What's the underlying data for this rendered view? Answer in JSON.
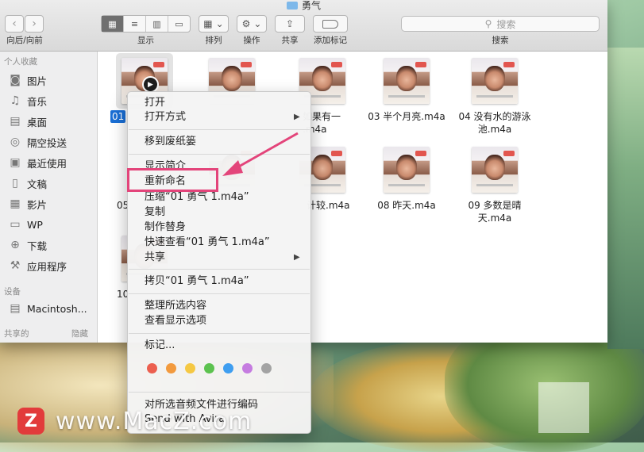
{
  "window": {
    "title": "勇气",
    "toolbar": {
      "back": "‹",
      "forward": "›",
      "nav_label": "向后/向前",
      "display_label": "显示",
      "arrange_label": "排列",
      "action_label": "操作",
      "share_label": "共享",
      "tag_label": "添加标记",
      "search_label": "搜索",
      "search_placeholder": "搜索"
    }
  },
  "sidebar": {
    "favorites_header": "个人收藏",
    "items": [
      {
        "label": "图片",
        "icon": "camera-icon"
      },
      {
        "label": "音乐",
        "icon": "music-note-icon"
      },
      {
        "label": "桌面",
        "icon": "desktop-icon"
      },
      {
        "label": "隔空投送",
        "icon": "airdrop-icon"
      },
      {
        "label": "最近使用",
        "icon": "recents-icon"
      },
      {
        "label": "文稿",
        "icon": "document-icon"
      },
      {
        "label": "影片",
        "icon": "film-icon"
      },
      {
        "label": "WP",
        "icon": "folder-icon"
      },
      {
        "label": "下载",
        "icon": "download-icon"
      },
      {
        "label": "应用程序",
        "icon": "applications-icon"
      }
    ],
    "devices_header": "设备",
    "device": "Macintosh...",
    "shared_header": "共享的",
    "hide_label": "隐藏"
  },
  "files": [
    {
      "name": "01"
    },
    {
      "name": ""
    },
    {
      "name": "如果有一\n.m4a"
    },
    {
      "name": "03 半个月亮.m4a"
    },
    {
      "name": "04 没有水的游泳\n池.m4a"
    },
    {
      "name": "05"
    },
    {
      "name": ""
    },
    {
      "name": "计较.m4a"
    },
    {
      "name": "08 昨天.m4a"
    },
    {
      "name": "09 多数是晴\n天.m4a"
    },
    {
      "name": "10"
    }
  ],
  "context_menu": {
    "open": "打开",
    "open_with": "打开方式",
    "trash": "移到废纸篓",
    "get_info": "显示简介",
    "rename": "重新命名",
    "compress": "压缩“01 勇气 1.m4a”",
    "duplicate": "复制",
    "make_alias": "制作替身",
    "quick_look": "快速查看“01 勇气 1.m4a”",
    "share": "共享",
    "copy": "拷贝“01 勇气 1.m4a”",
    "clean_up": "整理所选内容",
    "view_options": "查看显示选项",
    "tags": "标记...",
    "tag_colors": [
      "#ec5f4f",
      "#f29a3e",
      "#f5c843",
      "#5cc24f",
      "#3f9ef0",
      "#c57ce0",
      "#a3a3a3"
    ],
    "encode": "对所选音频文件进行编码",
    "service_line": "Send with Avira"
  },
  "watermark": {
    "logo": "Z",
    "text": "www.MacZ.com"
  }
}
